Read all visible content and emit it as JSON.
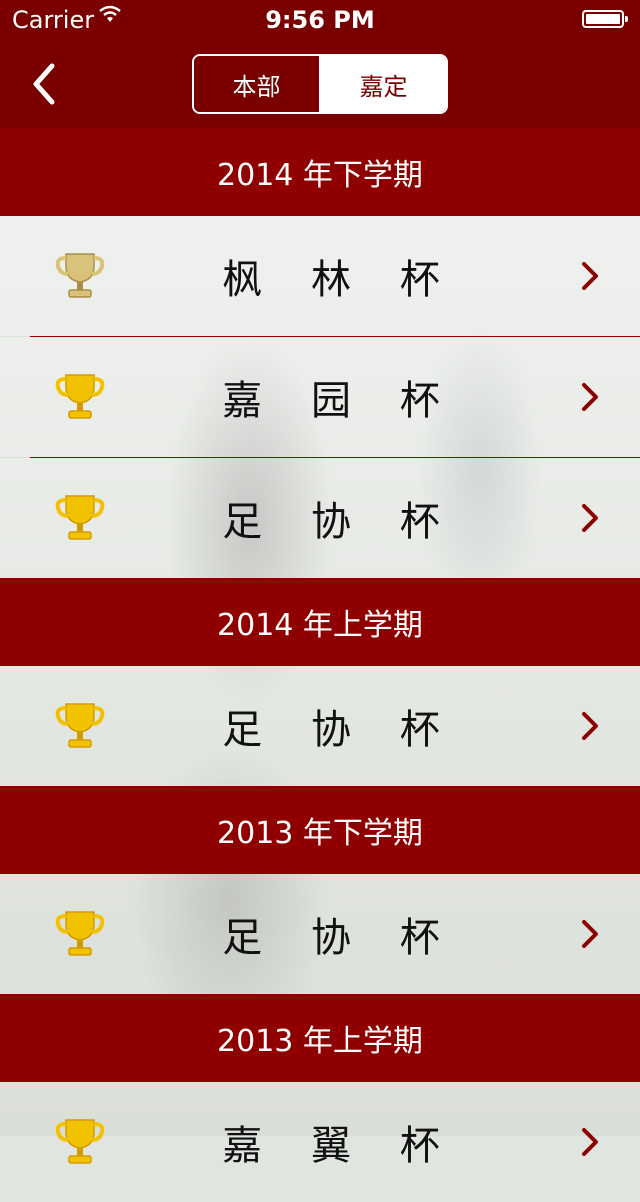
{
  "status_bar": {
    "carrier": "Carrier",
    "time": "9:56 PM"
  },
  "nav": {
    "segments": [
      "本部",
      "嘉定"
    ],
    "selected_segment": "嘉定"
  },
  "sections": [
    {
      "title": "2014 年下学期",
      "items": [
        {
          "name": "枫 林 杯",
          "trophy": "silver"
        },
        {
          "name": "嘉 园 杯",
          "trophy": "gold"
        },
        {
          "name": "足 协 杯",
          "trophy": "gold"
        }
      ]
    },
    {
      "title": "2014 年上学期",
      "items": [
        {
          "name": "足 协 杯",
          "trophy": "gold"
        }
      ]
    },
    {
      "title": "2013 年下学期",
      "items": [
        {
          "name": "足 协 杯",
          "trophy": "gold"
        }
      ]
    },
    {
      "title": "2013 年上学期",
      "items": [
        {
          "name": "嘉 翼 杯",
          "trophy": "gold"
        }
      ]
    }
  ],
  "colors": {
    "brand": "#7a0000",
    "section": "#8f0000",
    "gold": "#e6b800",
    "silver": "#b8a25a"
  }
}
